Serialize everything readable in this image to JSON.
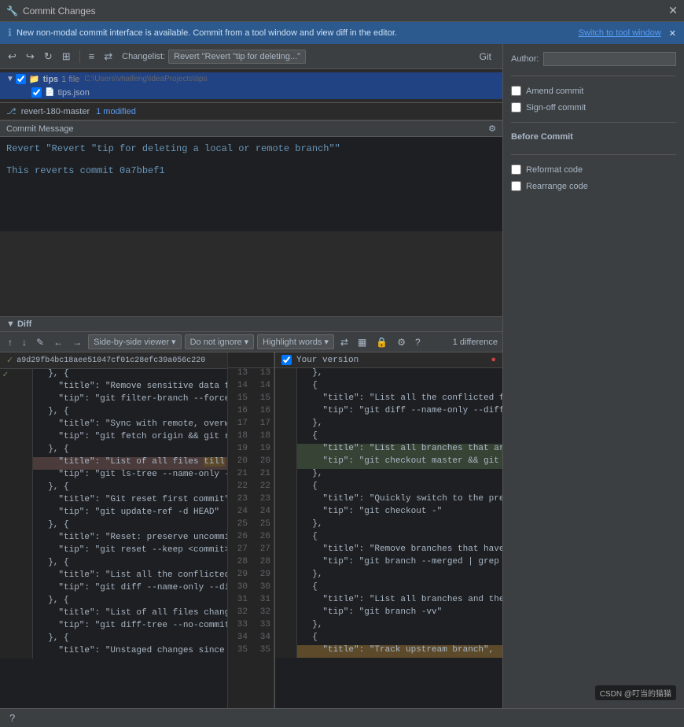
{
  "titleBar": {
    "icon": "🔧",
    "title": "Commit Changes",
    "closeBtn": "✕"
  },
  "infoBar": {
    "icon": "ℹ",
    "message": "New non-modal commit interface is available. Commit from a tool window and view diff in the editor.",
    "switchLink": "Switch to tool window",
    "closeBtn": "✕"
  },
  "toolbar": {
    "changelistLabel": "Changelist:",
    "changelistValue": "Revert \"Revert \"tip for deleting...\"",
    "gitTab": "Git"
  },
  "fileTree": {
    "rootItem": {
      "arrow": "▼",
      "checkbox": true,
      "folderIcon": "📁",
      "name": "tips",
      "meta": "1 file",
      "path": "C:\\Users\\vhaifeng\\IdeaProjects\\tips"
    },
    "fileItem": {
      "checkbox": true,
      "fileIcon": "{}",
      "name": "tips.json"
    }
  },
  "branchRow": {
    "icon": "⎇",
    "branch": "revert-180-master",
    "status": "1 modified"
  },
  "commitMsg": {
    "header": "Commit Message",
    "gearIcon": "⚙",
    "line1": "Revert \"Revert \"tip for deleting a local or remote branch\"\"",
    "line2": "",
    "line3": "This reverts commit 0a7bbef1"
  },
  "diff": {
    "header": "Diff",
    "toolbar": {
      "prevBtn": "↑",
      "nextBtn": "↓",
      "editBtn": "✎",
      "backBtn": "←",
      "fwdBtn": "→",
      "viewerLabel": "Side-by-side viewer",
      "ignoreLabel": "Do not ignore",
      "highlightLabel": "Highlight words",
      "syncBtn": "⇄",
      "columnsBtn": "▦",
      "lockBtn": "🔒",
      "settingsBtn": "⚙",
      "helpBtn": "?",
      "diffCount": "1 difference"
    },
    "leftHeader": "a9d29fb4bc18aee51047cf01c28efc39a056c220",
    "rightHeader": "Your version",
    "leftLines": [
      {
        "num": "",
        "content": "  }, {"
      },
      {
        "num": "",
        "content": "    \"title\": \"Remove sensitive data fr"
      },
      {
        "num": "",
        "content": "    \"tip\": \"git filter-branch --force"
      },
      {
        "num": "",
        "content": "  }, {"
      },
      {
        "num": "",
        "content": "    \"title\": \"Sync with remote, overwri"
      },
      {
        "num": "",
        "content": "    \"tip\": \"git fetch origin && git re"
      },
      {
        "num": "",
        "content": "  }, {"
      },
      {
        "num": "",
        "content": "    \"title\": \"List of all files till a"
      },
      {
        "num": "",
        "content": "    \"tip\": \"git ls-tree --name-only -r"
      },
      {
        "num": "",
        "content": "  }, {"
      },
      {
        "num": "",
        "content": "    \"title\": \"Git reset first commit\","
      },
      {
        "num": "",
        "content": "    \"tip\": \"git update-ref -d HEAD\""
      },
      {
        "num": "",
        "content": "  }, {"
      },
      {
        "num": "",
        "content": "    \"title\": \"Reset: preserve uncommit"
      },
      {
        "num": "",
        "content": "    \"tip\": \"git reset --keep <commit>\""
      },
      {
        "num": "",
        "content": "  }, {"
      },
      {
        "num": "",
        "content": "    \"title\": \"List all the conflicted"
      },
      {
        "num": "",
        "content": "    \"tip\": \"git diff --name-only --dif"
      },
      {
        "num": "",
        "content": "  }, {"
      },
      {
        "num": "",
        "content": "    \"title\": \"List of all files change"
      },
      {
        "num": "",
        "content": "    \"tip\": \"git diff-tree --no-commit-"
      },
      {
        "num": "",
        "content": "  }, {"
      },
      {
        "num": "",
        "content": "    \"title\": \"Unstaged changes since l"
      }
    ],
    "midNums": [
      13,
      14,
      15,
      16,
      17,
      18,
      19,
      20,
      21,
      22,
      23,
      24,
      25,
      26,
      27,
      28,
      29,
      30,
      31,
      32,
      33,
      34,
      35
    ],
    "rightLines": [
      {
        "num": "",
        "content": "  },"
      },
      {
        "num": "",
        "content": "  {"
      },
      {
        "num": "",
        "content": "    \"title\": \"List all the conflicted fil"
      },
      {
        "num": "",
        "content": "    \"tip\": \"git diff --name-only --diff-f"
      },
      {
        "num": "",
        "content": "  },"
      },
      {
        "num": "",
        "content": "  {"
      },
      {
        "num": "",
        "content": "    \"title\": \"List all branches that are c"
      },
      {
        "num": "",
        "content": "    \"tip\": \"git checkout master && git bra"
      },
      {
        "num": "",
        "content": "  },"
      },
      {
        "num": "",
        "content": "  {"
      },
      {
        "num": "",
        "content": "    \"title\": \"Quickly switch to the previo"
      },
      {
        "num": "",
        "content": "    \"tip\": \"git checkout -\""
      },
      {
        "num": "",
        "content": "  },"
      },
      {
        "num": "",
        "content": "  {"
      },
      {
        "num": "",
        "content": "    \"title\": \"Remove branches that have al"
      },
      {
        "num": "",
        "content": "    \"tip\": \"git branch --merged | grep -v"
      },
      {
        "num": "",
        "content": "  },"
      },
      {
        "num": "",
        "content": "  {"
      },
      {
        "num": "",
        "content": "    \"title\": \"List all branches and their"
      },
      {
        "num": "",
        "content": "    \"tip\": \"git branch -vv\""
      },
      {
        "num": "",
        "content": "  },"
      },
      {
        "num": "",
        "content": "  {"
      },
      {
        "num": "",
        "content": "    \"title\": \"Track upstream branch\","
      }
    ]
  },
  "rightPanel": {
    "authorLabel": "Author:",
    "authorPlaceholder": "",
    "amendCommitLabel": "Amend commit",
    "signOffLabel": "Sign-off commit",
    "beforeCommitTitle": "Before Commit",
    "reformatLabel": "Reformat code",
    "rearrangeLabel": "Rearrange code"
  },
  "bottomBar": {
    "helpIcon": "?",
    "watermark": "CSDN @叮当的猫猫"
  }
}
